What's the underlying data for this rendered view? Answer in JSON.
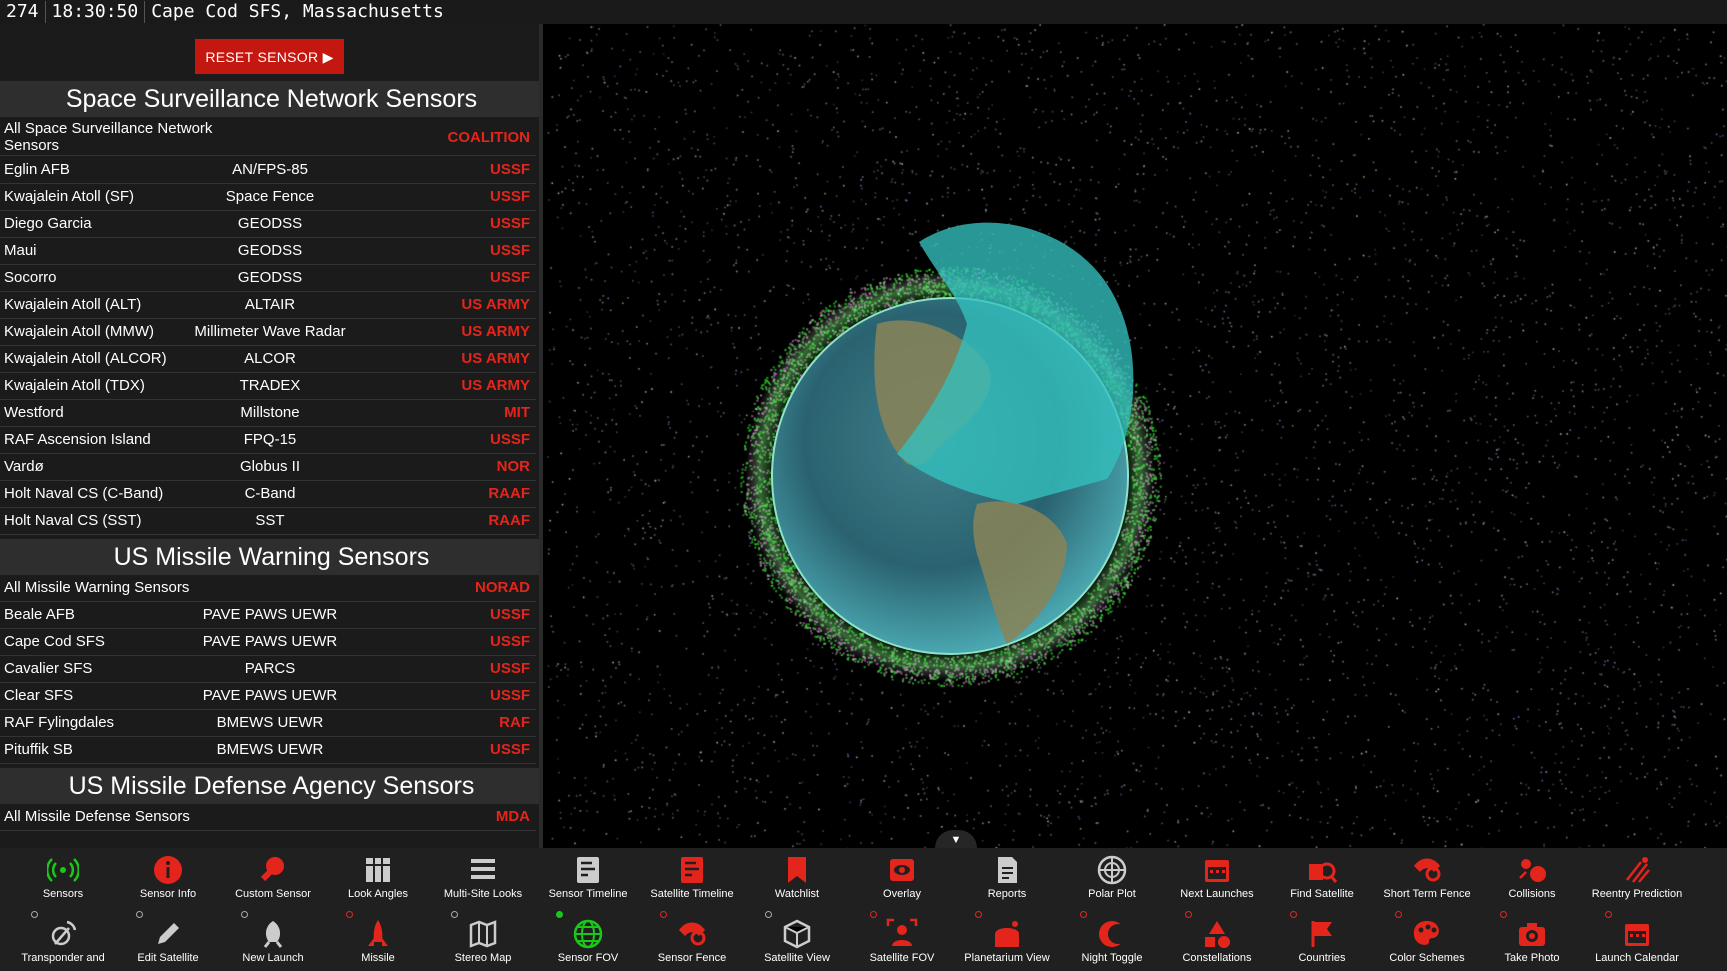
{
  "topbar": {
    "counter": "274",
    "time": "18:30:50",
    "location": "Cape Cod SFS, Massachusetts"
  },
  "sidebar": {
    "reset_label": "RESET SENSOR ▶",
    "sections": [
      {
        "title": "Space Surveillance Network Sensors",
        "rows": [
          {
            "name": "All Space Surveillance Network Sensors",
            "type": "",
            "owner": "COALITION"
          },
          {
            "name": "Eglin AFB",
            "type": "AN/FPS-85",
            "owner": "USSF"
          },
          {
            "name": "Kwajalein Atoll (SF)",
            "type": "Space Fence",
            "owner": "USSF"
          },
          {
            "name": "Diego Garcia",
            "type": "GEODSS",
            "owner": "USSF"
          },
          {
            "name": "Maui",
            "type": "GEODSS",
            "owner": "USSF"
          },
          {
            "name": "Socorro",
            "type": "GEODSS",
            "owner": "USSF"
          },
          {
            "name": "Kwajalein Atoll (ALT)",
            "type": "ALTAIR",
            "owner": "US ARMY"
          },
          {
            "name": "Kwajalein Atoll (MMW)",
            "type": "Millimeter Wave Radar",
            "owner": "US ARMY"
          },
          {
            "name": "Kwajalein Atoll (ALCOR)",
            "type": "ALCOR",
            "owner": "US ARMY"
          },
          {
            "name": "Kwajalein Atoll (TDX)",
            "type": "TRADEX",
            "owner": "US ARMY"
          },
          {
            "name": "Westford",
            "type": "Millstone",
            "owner": "MIT"
          },
          {
            "name": "RAF Ascension Island",
            "type": "FPQ-15",
            "owner": "USSF"
          },
          {
            "name": "Vardø",
            "type": "Globus II",
            "owner": "NOR"
          },
          {
            "name": "Holt Naval CS (C-Band)",
            "type": "C-Band",
            "owner": "RAAF"
          },
          {
            "name": "Holt Naval CS (SST)",
            "type": "SST",
            "owner": "RAAF"
          }
        ]
      },
      {
        "title": "US Missile Warning Sensors",
        "rows": [
          {
            "name": "All Missile Warning Sensors",
            "type": "",
            "owner": "NORAD"
          },
          {
            "name": "Beale AFB",
            "type": "PAVE PAWS UEWR",
            "owner": "USSF"
          },
          {
            "name": "Cape Cod SFS",
            "type": "PAVE PAWS UEWR",
            "owner": "USSF"
          },
          {
            "name": "Cavalier SFS",
            "type": "PARCS",
            "owner": "USSF"
          },
          {
            "name": "Clear SFS",
            "type": "PAVE PAWS UEWR",
            "owner": "USSF"
          },
          {
            "name": "RAF Fylingdales",
            "type": "BMEWS UEWR",
            "owner": "RAF"
          },
          {
            "name": "Pituffik SB",
            "type": "BMEWS UEWR",
            "owner": "USSF"
          }
        ]
      },
      {
        "title": "US Missile Defense Agency Sensors",
        "rows": [
          {
            "name": "All Missile Defense Sensors",
            "type": "",
            "owner": "MDA"
          }
        ]
      }
    ]
  },
  "collapse_glyph": "▼",
  "toolbar": {
    "row1": [
      {
        "label": "Sensors",
        "icon": "sensors-icon",
        "color": "#19c819"
      },
      {
        "label": "Sensor Info",
        "icon": "info-icon",
        "color": "#e4251b"
      },
      {
        "label": "Custom Sensor",
        "icon": "wrench-icon",
        "color": "#e4251b"
      },
      {
        "label": "Look Angles",
        "icon": "table-icon",
        "color": "#cccccc"
      },
      {
        "label": "Multi-Site Looks",
        "icon": "list-icon",
        "color": "#cccccc"
      },
      {
        "label": "Sensor Timeline",
        "icon": "timeline-icon",
        "color": "#cccccc"
      },
      {
        "label": "Satellite Timeline",
        "icon": "timeline-icon",
        "color": "#e4251b"
      },
      {
        "label": "Watchlist",
        "icon": "bookmark-icon",
        "color": "#e4251b"
      },
      {
        "label": "Overlay",
        "icon": "eye-icon",
        "color": "#e4251b"
      },
      {
        "label": "Reports",
        "icon": "report-icon",
        "color": "#cccccc"
      },
      {
        "label": "Polar Plot",
        "icon": "polar-icon",
        "color": "#cccccc"
      },
      {
        "label": "Next Launches",
        "icon": "calendar-icon",
        "color": "#e4251b"
      },
      {
        "label": "Find Satellite",
        "icon": "search-icon",
        "color": "#e4251b"
      },
      {
        "label": "Short Term Fence",
        "icon": "fence-icon",
        "color": "#e4251b"
      },
      {
        "label": "Collisions",
        "icon": "collision-icon",
        "color": "#e4251b"
      },
      {
        "label": "Reentry Prediction",
        "icon": "reentry-icon",
        "color": "#e4251b"
      }
    ],
    "row2": [
      {
        "label": "Transponder and",
        "icon": "transponder-icon",
        "color": "#cccccc",
        "dot": "grey"
      },
      {
        "label": "Edit Satellite",
        "icon": "pencil-icon",
        "color": "#cccccc",
        "dot": "grey"
      },
      {
        "label": "New Launch",
        "icon": "rocket-icon",
        "color": "#cccccc",
        "dot": "grey"
      },
      {
        "label": "Missile",
        "icon": "missile-icon",
        "color": "#e4251b",
        "dot": "red"
      },
      {
        "label": "Stereo Map",
        "icon": "map-icon",
        "color": "#cccccc",
        "dot": "grey"
      },
      {
        "label": "Sensor FOV",
        "icon": "globe-icon",
        "color": "#19c819",
        "dot": "green"
      },
      {
        "label": "Sensor Fence",
        "icon": "fence-icon",
        "color": "#e4251b",
        "dot": "red"
      },
      {
        "label": "Satellite View",
        "icon": "cube-icon",
        "color": "#cccccc",
        "dot": "grey"
      },
      {
        "label": "Satellite FOV",
        "icon": "fov-icon",
        "color": "#e4251b",
        "dot": "red"
      },
      {
        "label": "Planetarium View",
        "icon": "planetarium-icon",
        "color": "#e4251b",
        "dot": "red"
      },
      {
        "label": "Night Toggle",
        "icon": "moon-icon",
        "color": "#e4251b",
        "dot": "red"
      },
      {
        "label": "Constellations",
        "icon": "shapes-icon",
        "color": "#e4251b",
        "dot": "red"
      },
      {
        "label": "Countries",
        "icon": "flag-icon",
        "color": "#e4251b",
        "dot": "red"
      },
      {
        "label": "Color Schemes",
        "icon": "palette-icon",
        "color": "#e4251b",
        "dot": "red"
      },
      {
        "label": "Take Photo",
        "icon": "camera-icon",
        "color": "#e4251b",
        "dot": "red"
      },
      {
        "label": "Launch Calendar",
        "icon": "calendar-icon",
        "color": "#e4251b",
        "dot": "red"
      }
    ]
  }
}
